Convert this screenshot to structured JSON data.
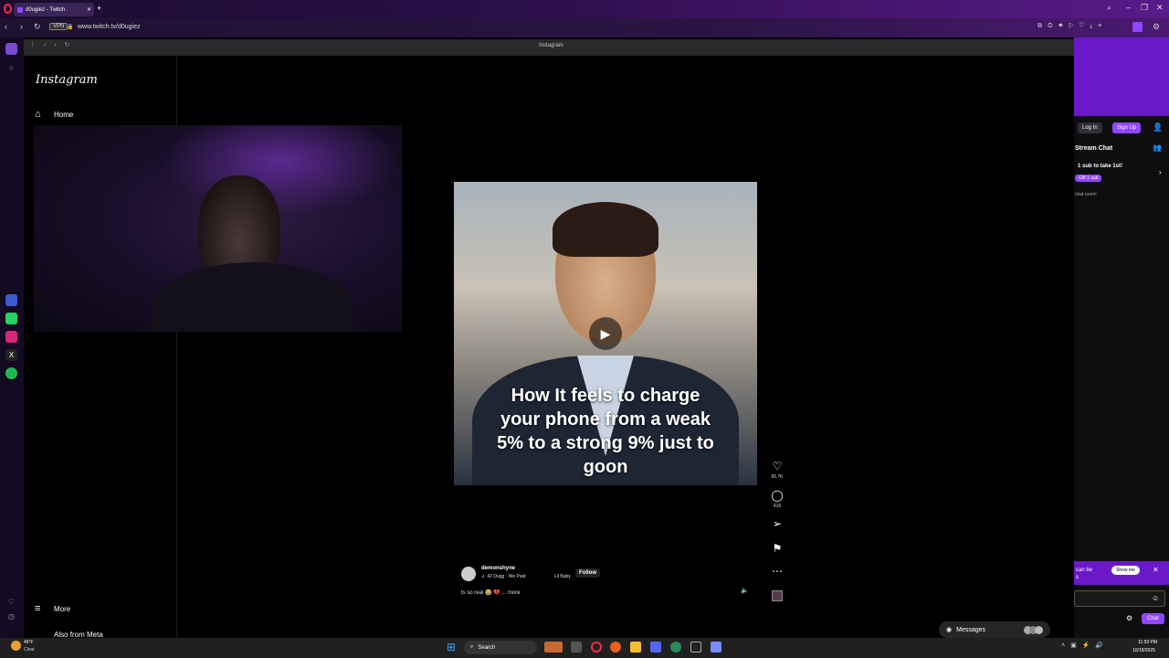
{
  "browser": {
    "tab_title": "d0ugiez - Twitch",
    "url": "www.twitch.tv/d0ugiez",
    "vpn_label": "VPN",
    "inner_title": "Instagram"
  },
  "instagram": {
    "logo": "Instagram",
    "nav_home": "Home",
    "nav_more": "More",
    "nav_meta": "Also from Meta",
    "caption": "How It feels to charge your phone from a weak 5% to a strong 9% just to goon",
    "likes": "65.7K",
    "comments": "416",
    "username": "demonshyne",
    "audio": "♬ 42 Dugg · We Paid",
    "audio_artist": "Lil Baby",
    "follow_label": "Follow",
    "description": "ts so real 😭 💔 ... more",
    "messages_label": "Messages"
  },
  "twitch": {
    "login_label": "Log In",
    "signup_label": "Sign Up",
    "stream_chat": "Stream Chat",
    "sub_text": "1 sub to take 1st!",
    "gift_label": "Gift 1 sub",
    "welcome_text": "chat room!",
    "promo_text": "can be\ns",
    "show_me_label": "Show me",
    "chat_button": "Chat"
  },
  "taskbar": {
    "temperature": "46°F",
    "condition": "Clear",
    "search_label": "Search",
    "time": "11:59 PM",
    "date": "10/18/2025"
  },
  "colors": {
    "twitch_purple": "#9147ff",
    "twitch_banner": "#6a18c8",
    "browser_accent": "#5a1a8a"
  }
}
